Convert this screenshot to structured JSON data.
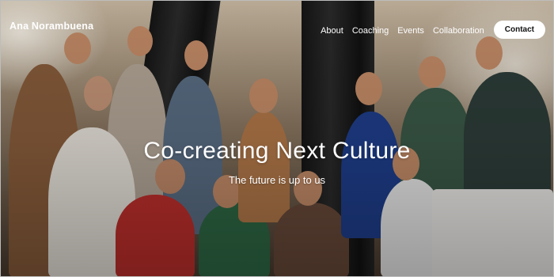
{
  "header": {
    "logo_text": "Ana Norambuena",
    "nav": [
      {
        "label": "About"
      },
      {
        "label": "Coaching"
      },
      {
        "label": "Events"
      },
      {
        "label": "Collaboration"
      }
    ],
    "cta_label": "Contact"
  },
  "hero": {
    "title": "Co-creating Next Culture",
    "subtitle": "The future is up to us",
    "photo_content": "group-photo"
  },
  "colors": {
    "text": "#ffffff",
    "cta_background": "#ffffff",
    "cta_text": "#111111"
  }
}
